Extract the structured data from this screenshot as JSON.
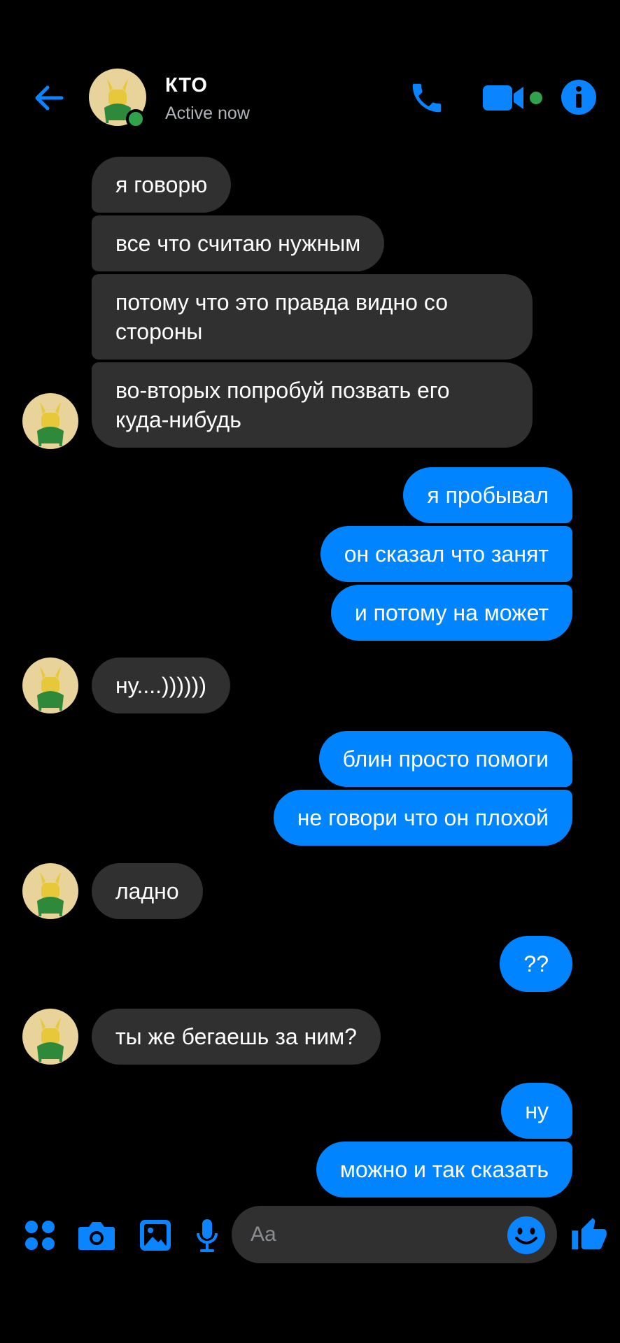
{
  "header": {
    "contact_name": "КТО",
    "status": "Active now",
    "icons": {
      "back": "back-arrow-icon",
      "call": "phone-icon",
      "video": "video-camera-icon",
      "info": "info-icon"
    }
  },
  "messages": [
    {
      "side": "in",
      "text": "я говорю"
    },
    {
      "side": "in",
      "text": "все что считаю нужным"
    },
    {
      "side": "in",
      "text": "потому что это правда видно со\nстороны"
    },
    {
      "side": "in",
      "text": "во-вторых попробуй позвать его\nкуда-нибудь"
    },
    {
      "side": "out",
      "text": "я пробывал"
    },
    {
      "side": "out",
      "text": "он сказал что занят"
    },
    {
      "side": "out",
      "text": "и потому на может"
    },
    {
      "side": "in",
      "text": "ну....))))))"
    },
    {
      "side": "out",
      "text": "блин просто помоги"
    },
    {
      "side": "out",
      "text": "не говори что он плохой"
    },
    {
      "side": "in",
      "text": "ладно"
    },
    {
      "side": "out",
      "text": "??"
    },
    {
      "side": "in",
      "text": "ты же бегаешь за ним?"
    },
    {
      "side": "out",
      "text": "ну"
    },
    {
      "side": "out",
      "text": "можно и так сказать"
    }
  ],
  "composer": {
    "placeholder": "Aa",
    "icons": [
      "apps-grid-icon",
      "camera-icon",
      "gallery-icon",
      "microphone-icon",
      "emoji-icon",
      "thumbs-up-icon"
    ]
  },
  "colors": {
    "background": "#000000",
    "accent": "#0084ff",
    "incoming_bubble": "#303030",
    "online": "#31a24c"
  }
}
